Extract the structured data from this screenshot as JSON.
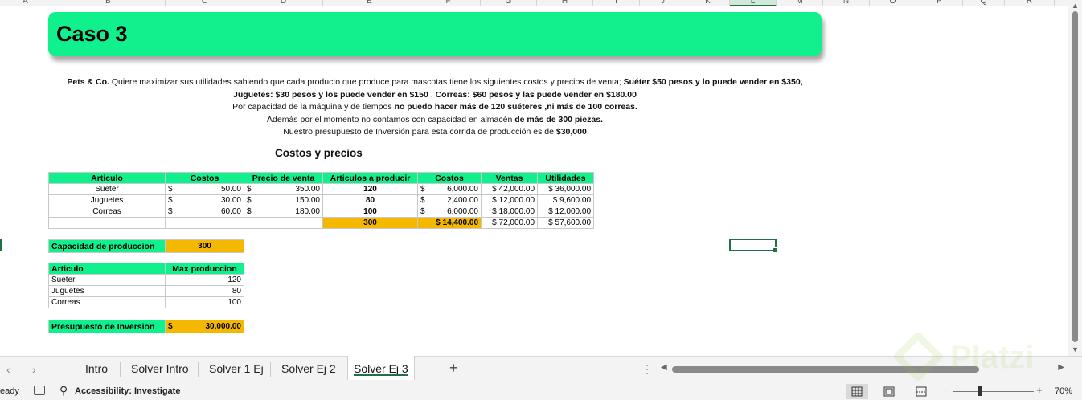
{
  "columns": [
    "A",
    "B",
    "C",
    "D",
    "E",
    "F",
    "G",
    "H",
    "I",
    "J",
    "K",
    "L",
    "M",
    "N",
    "O",
    "P",
    "Q",
    "R"
  ],
  "selected_column": "L",
  "title": "Caso 3",
  "description": {
    "line1_a": "Pets & Co.",
    "line1_b": " Quiere maximizar sus utilidades sabiendo que cada producto que produce para mascotas tiene los siguientes costos y precios de venta; ",
    "line1_c": "Suéter $50 pesos y lo puede vender en $350, Juguetes: $30 pesos y los puede vender en $150",
    "line1_d": " , ",
    "line1_e": "Correas: $60 pesos y las puede vender en $180.00",
    "line2_a": "Por capacidad de la máquina y de tiempos ",
    "line2_b": "no puedo hacer más de 120 suéteres ,ni más de 100 correas.",
    "line3_a": "Además por el momento no contamos con capacidad en almacén ",
    "line3_b": "de más de 300 piezas.",
    "line4_a": "Nuestro presupuesto de Inversión para esta corrida de producción es de ",
    "line4_b": "$30,000"
  },
  "section_title": "Costos y precios",
  "main_table": {
    "headers": [
      "Articulo",
      "Costos",
      "Precio de venta",
      "Articulos a producir",
      "Costos",
      "Ventas",
      "Utilidades"
    ],
    "currency": "$",
    "rows": [
      {
        "articulo": "Sueter",
        "costo": "50.00",
        "precio": "350.00",
        "producir": "120",
        "costos": "6,000.00",
        "ventas": "$ 42,000.00",
        "utilidades": "$ 36,000.00"
      },
      {
        "articulo": "Juguetes",
        "costo": "30.00",
        "precio": "150.00",
        "producir": "80",
        "costos": "2,400.00",
        "ventas": "$ 12,000.00",
        "utilidades": "$   9,600.00"
      },
      {
        "articulo": "Correas",
        "costo": "60.00",
        "precio": "180.00",
        "producir": "100",
        "costos": "6,000.00",
        "ventas": "$ 18,000.00",
        "utilidades": "$ 12,000.00"
      }
    ],
    "totals": {
      "producir": "300",
      "costos": "$ 14,400.00",
      "ventas": "$ 72,000.00",
      "utilidades": "$ 57,600.00"
    }
  },
  "capacity": {
    "label": "Capacidad de produccion",
    "value": "300"
  },
  "max_table": {
    "headers": [
      "Articulo",
      "Max produccion"
    ],
    "rows": [
      {
        "articulo": "Sueter",
        "max": "120"
      },
      {
        "articulo": "Juguetes",
        "max": "80"
      },
      {
        "articulo": "Correas",
        "max": "100"
      }
    ]
  },
  "budget": {
    "label": "Presupuesto de Inversion",
    "currency": "$",
    "value": "30,000.00"
  },
  "tabs": [
    "Intro",
    "Solver Intro",
    "Solver 1 Ej",
    "Solver Ej 2",
    "Solver Ej 3"
  ],
  "active_tab": "Solver Ej 3",
  "status": {
    "ready": "eady",
    "accessibility": "Accessibility: Investigate",
    "zoom": "70%"
  },
  "colors": {
    "accent_green": "#10f08c",
    "gold": "#f5b800",
    "excel_green": "#1e7145"
  },
  "watermark": "Platzi"
}
